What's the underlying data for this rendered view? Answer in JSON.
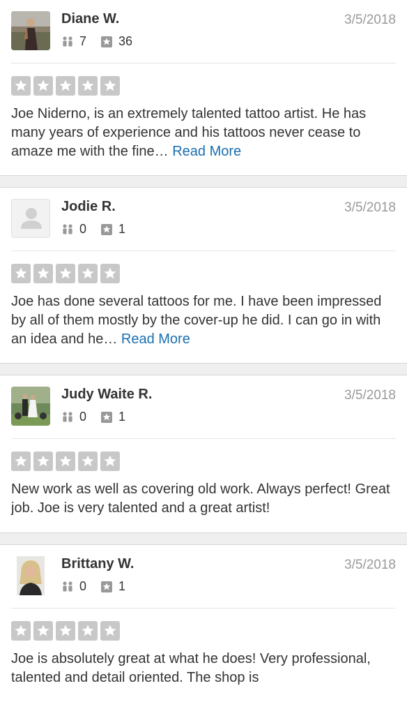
{
  "reviews": [
    {
      "name": "Diane W.",
      "date": "3/5/2018",
      "friends": "7",
      "review_count": "36",
      "avatar_icon": "photo-avatar",
      "rating": 5,
      "text": "Joe Niderno, is an extremely talented tattoo artist. He has many years of experience and his tattoos never cease to amaze me with the fine…",
      "read_more": "Read More"
    },
    {
      "name": "Jodie R.",
      "date": "3/5/2018",
      "friends": "0",
      "review_count": "1",
      "avatar_icon": "default-user-avatar",
      "rating": 5,
      "text": "Joe has done several tattoos for me. I have been impressed by all of them mostly by the cover-up he did.  I can go in with an idea and he…",
      "read_more": "Read More"
    },
    {
      "name": "Judy Waite R.",
      "date": "3/5/2018",
      "friends": "0",
      "review_count": "1",
      "avatar_icon": "photo-avatar",
      "rating": 5,
      "text": "New work as well as covering old work. Always perfect! Great job. Joe is very talented and a great artist!",
      "read_more": ""
    },
    {
      "name": "Brittany W.",
      "date": "3/5/2018",
      "friends": "0",
      "review_count": "1",
      "avatar_icon": "photo-avatar",
      "rating": 5,
      "text": "Joe is absolutely great at what he does! Very professional, talented and detail oriented. The shop is",
      "read_more": ""
    }
  ],
  "colors": {
    "star_box": "#c8c8c8",
    "link": "#1a6fb0",
    "date": "#999999",
    "separator": "#efefef"
  }
}
